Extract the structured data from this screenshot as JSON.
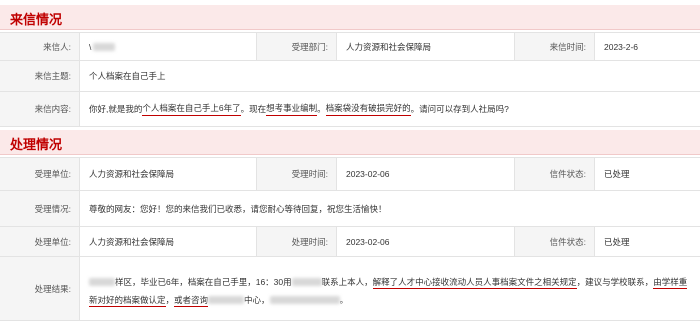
{
  "letter_section": {
    "title": "来信情况",
    "rows": {
      "sender_label": "来信人:",
      "sender_value": "\\",
      "dept_label": "受理部门:",
      "dept_value": "人力资源和社会保障局",
      "date_label": "来信时间:",
      "date_value": "2023-2-6",
      "subject_label": "来信主题:",
      "subject_value": "个人档案在自己手上",
      "content_label": "来信内容:",
      "content_parts": [
        "你好,就是我的",
        "个人档案在自己手上6年了",
        "。现在",
        "想考事业编制",
        "。",
        "档案袋没有破损完好的",
        "。请问可以存到人社局吗?"
      ]
    }
  },
  "handling_section": {
    "title": "处理情况",
    "accept_unit_label": "受理单位:",
    "accept_unit_value": "人力资源和社会保障局",
    "accept_time_label": "受理时间:",
    "accept_time_value": "2023-02-06",
    "status_label": "信件状态:",
    "status_value": "已处理",
    "accept_info_label": "受理情况:",
    "accept_info_value": "尊敬的网友：您好！您的来信我们已收悉，请您耐心等待回复，祝您生活愉快！",
    "handle_unit_label": "处理单位:",
    "handle_unit_value": "人力资源和社会保障局",
    "handle_time_label": "处理时间:",
    "handle_time_value": "2023-02-06",
    "status2_label": "信件状态:",
    "status2_value": "已处理",
    "result_label": "处理结果:",
    "result_parts": [
      "样区，毕业已6年，档案在自己手里，16：30用",
      "联系上本人，",
      "解释了人才中心接收流动人员人事档案文件之相关规定",
      "，建议与学校联系，",
      "由学样重新对好的档案做认定",
      "，",
      "或者咨询",
      "中心，",
      "。"
    ]
  }
}
